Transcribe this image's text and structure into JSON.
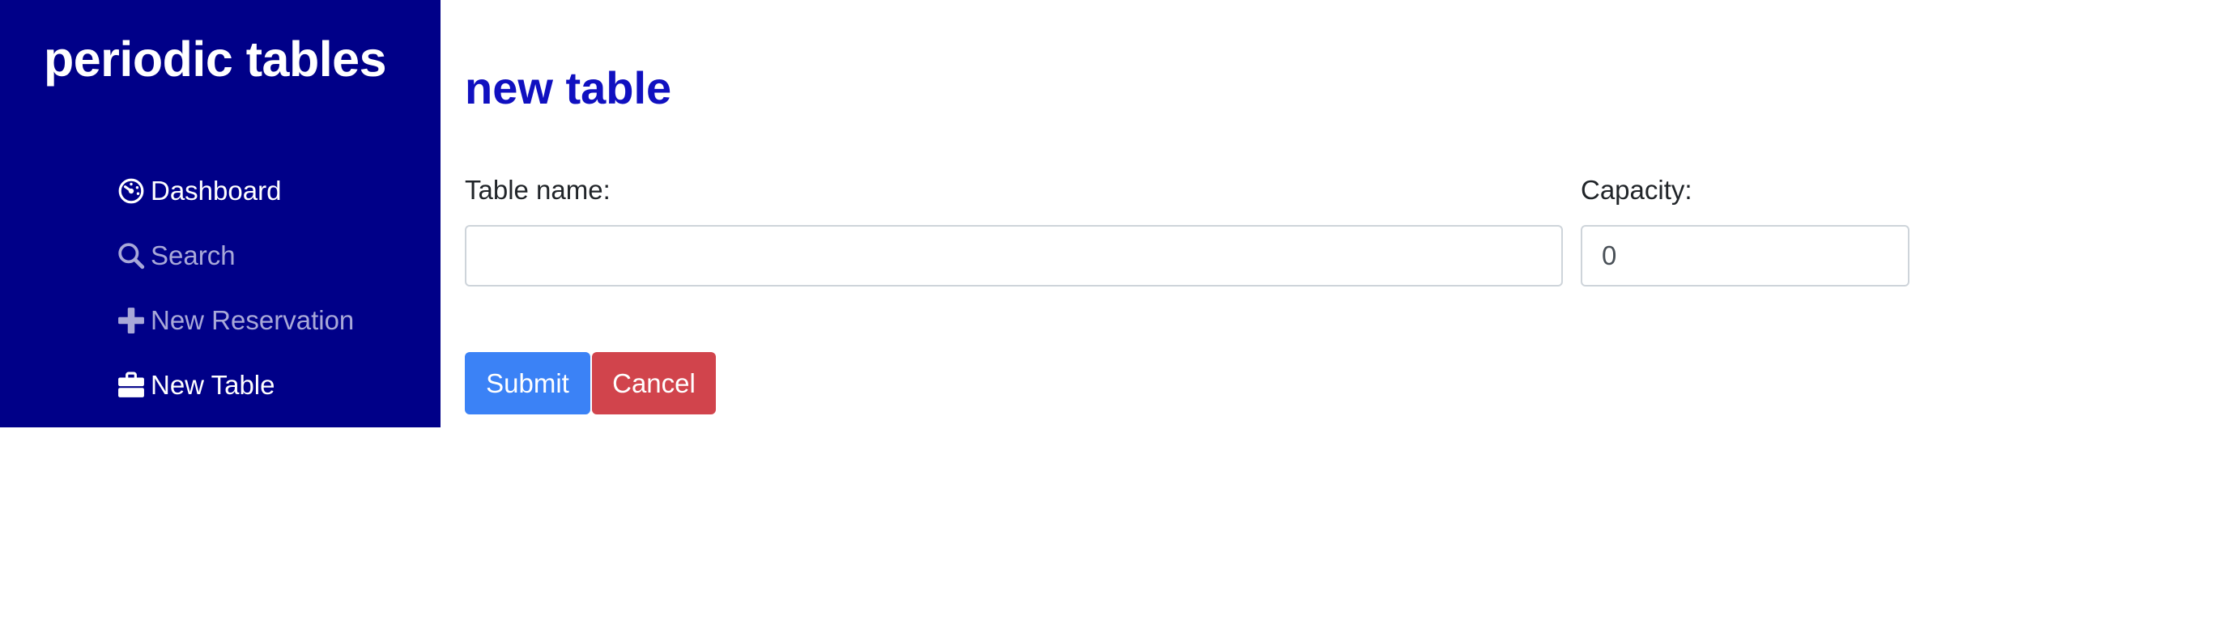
{
  "sidebar": {
    "brand": "periodic tables",
    "items": [
      {
        "label": "Dashboard",
        "icon": "dashboard-icon",
        "state": "active"
      },
      {
        "label": "Search",
        "icon": "search-icon",
        "state": "muted"
      },
      {
        "label": "New Reservation",
        "icon": "plus-icon",
        "state": "muted"
      },
      {
        "label": "New Table",
        "icon": "briefcase-icon",
        "state": "active"
      }
    ]
  },
  "main": {
    "title": "new table",
    "form": {
      "table_name_label": "Table name:",
      "table_name_value": "",
      "capacity_label": "Capacity:",
      "capacity_value": "0",
      "submit_label": "Submit",
      "cancel_label": "Cancel"
    }
  },
  "colors": {
    "sidebar_bg": "#000088",
    "title": "#1010c0",
    "submit": "#3b82f6",
    "cancel": "#d1444c"
  }
}
